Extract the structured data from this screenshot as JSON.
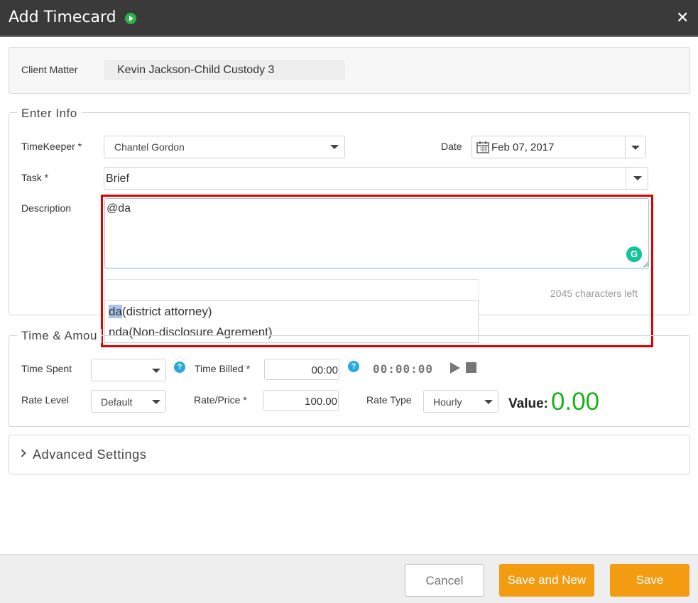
{
  "header": {
    "title": "Add Timecard",
    "close": "✕"
  },
  "client": {
    "label": "Client Matter",
    "value": "Kevin Jackson-Child Custody 3"
  },
  "enter_info": {
    "legend": "Enter Info",
    "timekeeper_label": "TimeKeeper *",
    "timekeeper_value": "Chantel Gordon",
    "date_label": "Date",
    "date_value": "Feb 07, 2017",
    "task_label": "Task *",
    "task_value": "Brief",
    "description_label": "Description",
    "description_value": "@da",
    "chars_left": "2045 characters left",
    "suggestions": [
      {
        "match": "da",
        "rest": "(district attorney)"
      },
      {
        "match": "",
        "rest": "nda(Non-disclosure Agrement)"
      }
    ]
  },
  "time_amount": {
    "legend": "Time & Amou",
    "time_spent_label": "Time Spent",
    "time_billed_label": "Time Billed *",
    "time_billed_value": "00:00",
    "timer": "00:00:00",
    "rate_level_label": "Rate Level",
    "rate_level_value": "Default",
    "rate_price_label": "Rate/Price *",
    "rate_price_value": "100.00",
    "rate_type_label": "Rate Type",
    "rate_type_value": "Hourly",
    "value_label": "Value:",
    "value_amount": "0.00"
  },
  "advanced": {
    "label": "Advanced Settings"
  },
  "footer": {
    "cancel": "Cancel",
    "save_new": "Save and New",
    "save": "Save"
  },
  "colors": {
    "accent": "#f39c12",
    "value_green": "#1bb31b",
    "highlight_red": "#e00000"
  }
}
